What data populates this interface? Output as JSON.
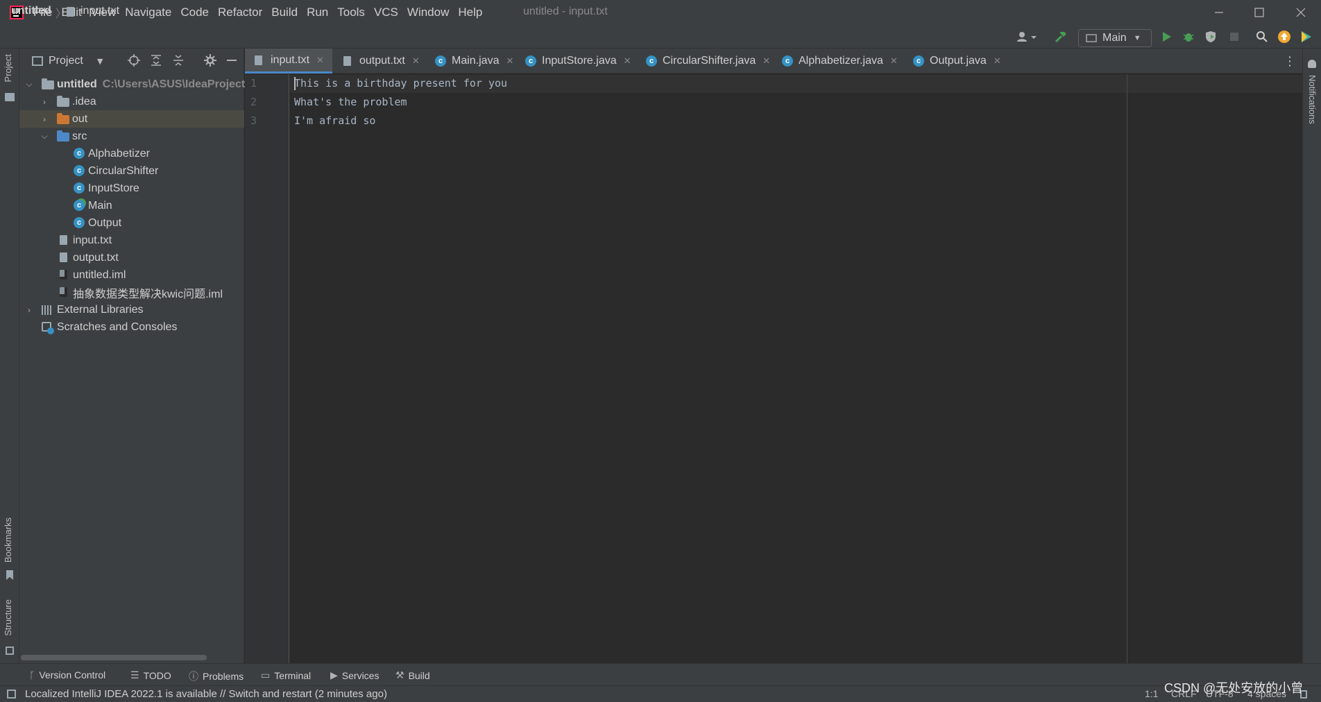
{
  "window": {
    "title": "untitled - input.txt",
    "logo_text": "IJ",
    "menu": [
      "File",
      "Edit",
      "View",
      "Navigate",
      "Code",
      "Refactor",
      "Build",
      "Run",
      "Tools",
      "VCS",
      "Window",
      "Help"
    ]
  },
  "breadcrumb": {
    "project": "untitled",
    "separator": "〉",
    "file": "input.txt"
  },
  "toolbar": {
    "run_config": "Main"
  },
  "left_strip": {
    "project": "Project",
    "bookmarks": "Bookmarks",
    "structure": "Structure"
  },
  "right_strip": {
    "notifications": "Notifications"
  },
  "project_panel": {
    "title": "Project",
    "tree": {
      "root": {
        "label": "untitled",
        "path": "C:\\Users\\ASUS\\IdeaProjects\\"
      },
      "idea": ".idea",
      "out": "out",
      "src": "src",
      "classes": [
        "Alphabetizer",
        "CircularShifter",
        "InputStore",
        "Main",
        "Output"
      ],
      "files": [
        "input.txt",
        "output.txt",
        "untitled.iml",
        "抽象数据类型解决kwic问题.iml"
      ],
      "external_libraries": "External Libraries",
      "scratches": "Scratches and Consoles"
    }
  },
  "tabs": [
    {
      "label": "input.txt",
      "type": "text",
      "active": true
    },
    {
      "label": "output.txt",
      "type": "text",
      "active": false
    },
    {
      "label": "Main.java",
      "type": "class",
      "active": false
    },
    {
      "label": "InputStore.java",
      "type": "class",
      "active": false
    },
    {
      "label": "CircularShifter.java",
      "type": "class",
      "active": false
    },
    {
      "label": "Alphabetizer.java",
      "type": "class",
      "active": false
    },
    {
      "label": "Output.java",
      "type": "class",
      "active": false
    }
  ],
  "editor": {
    "line_numbers": [
      "1",
      "2",
      "3"
    ],
    "lines": [
      "This is a birthday present for you",
      "What's the problem",
      "I'm afraid so"
    ]
  },
  "tool_windows": {
    "version_control": "Version Control",
    "todo": "TODO",
    "problems": "Problems",
    "terminal": "Terminal",
    "services": "Services",
    "build": "Build"
  },
  "status": {
    "message": "Localized IntelliJ IDEA 2022.1 is available // Switch and restart (2 minutes ago)",
    "position": "1:1",
    "line_sep": "CRLF",
    "encoding": "UTF-8",
    "indent": "4 spaces"
  },
  "watermark": "CSDN @无处安放的小曾",
  "colors": {
    "accent": "#4a88c7",
    "class_icon": "#3592c4",
    "run_green": "#499c54",
    "background": "#2b2b2b",
    "panel": "#3c3f41"
  }
}
